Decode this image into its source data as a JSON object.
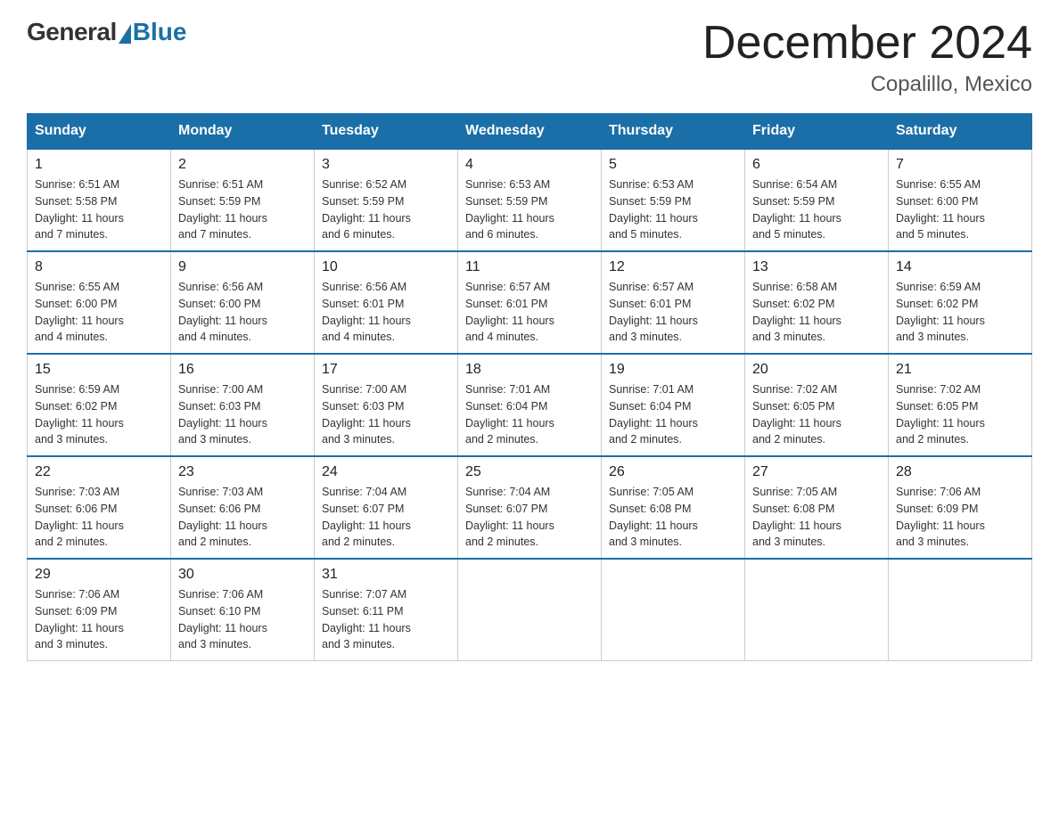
{
  "logo": {
    "general": "General",
    "blue": "Blue"
  },
  "title": "December 2024",
  "subtitle": "Copalillo, Mexico",
  "days_of_week": [
    "Sunday",
    "Monday",
    "Tuesday",
    "Wednesday",
    "Thursday",
    "Friday",
    "Saturday"
  ],
  "weeks": [
    [
      {
        "num": "1",
        "info": "Sunrise: 6:51 AM\nSunset: 5:58 PM\nDaylight: 11 hours\nand 7 minutes."
      },
      {
        "num": "2",
        "info": "Sunrise: 6:51 AM\nSunset: 5:59 PM\nDaylight: 11 hours\nand 7 minutes."
      },
      {
        "num": "3",
        "info": "Sunrise: 6:52 AM\nSunset: 5:59 PM\nDaylight: 11 hours\nand 6 minutes."
      },
      {
        "num": "4",
        "info": "Sunrise: 6:53 AM\nSunset: 5:59 PM\nDaylight: 11 hours\nand 6 minutes."
      },
      {
        "num": "5",
        "info": "Sunrise: 6:53 AM\nSunset: 5:59 PM\nDaylight: 11 hours\nand 5 minutes."
      },
      {
        "num": "6",
        "info": "Sunrise: 6:54 AM\nSunset: 5:59 PM\nDaylight: 11 hours\nand 5 minutes."
      },
      {
        "num": "7",
        "info": "Sunrise: 6:55 AM\nSunset: 6:00 PM\nDaylight: 11 hours\nand 5 minutes."
      }
    ],
    [
      {
        "num": "8",
        "info": "Sunrise: 6:55 AM\nSunset: 6:00 PM\nDaylight: 11 hours\nand 4 minutes."
      },
      {
        "num": "9",
        "info": "Sunrise: 6:56 AM\nSunset: 6:00 PM\nDaylight: 11 hours\nand 4 minutes."
      },
      {
        "num": "10",
        "info": "Sunrise: 6:56 AM\nSunset: 6:01 PM\nDaylight: 11 hours\nand 4 minutes."
      },
      {
        "num": "11",
        "info": "Sunrise: 6:57 AM\nSunset: 6:01 PM\nDaylight: 11 hours\nand 4 minutes."
      },
      {
        "num": "12",
        "info": "Sunrise: 6:57 AM\nSunset: 6:01 PM\nDaylight: 11 hours\nand 3 minutes."
      },
      {
        "num": "13",
        "info": "Sunrise: 6:58 AM\nSunset: 6:02 PM\nDaylight: 11 hours\nand 3 minutes."
      },
      {
        "num": "14",
        "info": "Sunrise: 6:59 AM\nSunset: 6:02 PM\nDaylight: 11 hours\nand 3 minutes."
      }
    ],
    [
      {
        "num": "15",
        "info": "Sunrise: 6:59 AM\nSunset: 6:02 PM\nDaylight: 11 hours\nand 3 minutes."
      },
      {
        "num": "16",
        "info": "Sunrise: 7:00 AM\nSunset: 6:03 PM\nDaylight: 11 hours\nand 3 minutes."
      },
      {
        "num": "17",
        "info": "Sunrise: 7:00 AM\nSunset: 6:03 PM\nDaylight: 11 hours\nand 3 minutes."
      },
      {
        "num": "18",
        "info": "Sunrise: 7:01 AM\nSunset: 6:04 PM\nDaylight: 11 hours\nand 2 minutes."
      },
      {
        "num": "19",
        "info": "Sunrise: 7:01 AM\nSunset: 6:04 PM\nDaylight: 11 hours\nand 2 minutes."
      },
      {
        "num": "20",
        "info": "Sunrise: 7:02 AM\nSunset: 6:05 PM\nDaylight: 11 hours\nand 2 minutes."
      },
      {
        "num": "21",
        "info": "Sunrise: 7:02 AM\nSunset: 6:05 PM\nDaylight: 11 hours\nand 2 minutes."
      }
    ],
    [
      {
        "num": "22",
        "info": "Sunrise: 7:03 AM\nSunset: 6:06 PM\nDaylight: 11 hours\nand 2 minutes."
      },
      {
        "num": "23",
        "info": "Sunrise: 7:03 AM\nSunset: 6:06 PM\nDaylight: 11 hours\nand 2 minutes."
      },
      {
        "num": "24",
        "info": "Sunrise: 7:04 AM\nSunset: 6:07 PM\nDaylight: 11 hours\nand 2 minutes."
      },
      {
        "num": "25",
        "info": "Sunrise: 7:04 AM\nSunset: 6:07 PM\nDaylight: 11 hours\nand 2 minutes."
      },
      {
        "num": "26",
        "info": "Sunrise: 7:05 AM\nSunset: 6:08 PM\nDaylight: 11 hours\nand 3 minutes."
      },
      {
        "num": "27",
        "info": "Sunrise: 7:05 AM\nSunset: 6:08 PM\nDaylight: 11 hours\nand 3 minutes."
      },
      {
        "num": "28",
        "info": "Sunrise: 7:06 AM\nSunset: 6:09 PM\nDaylight: 11 hours\nand 3 minutes."
      }
    ],
    [
      {
        "num": "29",
        "info": "Sunrise: 7:06 AM\nSunset: 6:09 PM\nDaylight: 11 hours\nand 3 minutes."
      },
      {
        "num": "30",
        "info": "Sunrise: 7:06 AM\nSunset: 6:10 PM\nDaylight: 11 hours\nand 3 minutes."
      },
      {
        "num": "31",
        "info": "Sunrise: 7:07 AM\nSunset: 6:11 PM\nDaylight: 11 hours\nand 3 minutes."
      },
      null,
      null,
      null,
      null
    ]
  ]
}
